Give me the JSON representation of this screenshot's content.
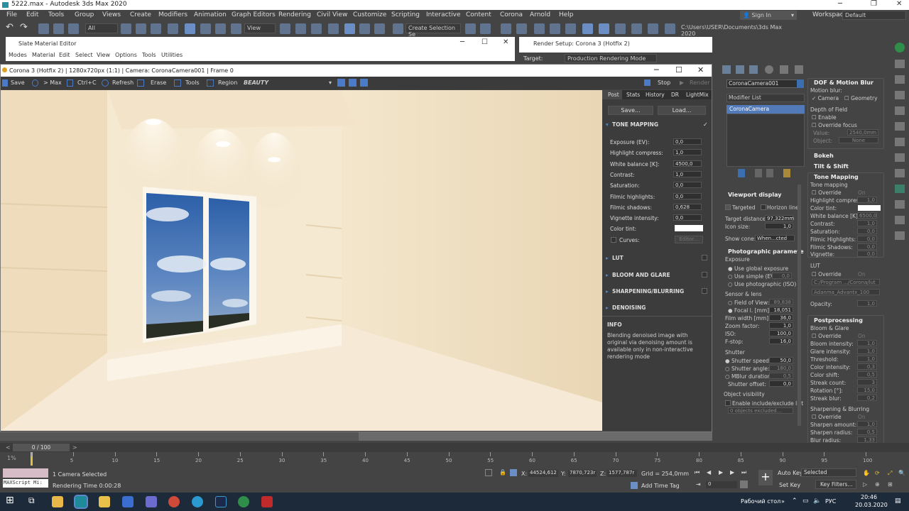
{
  "app": {
    "title": "5222.max - Autodesk 3ds Max 2020"
  },
  "menu": [
    "File",
    "Edit",
    "Tools",
    "Group",
    "Views",
    "Create",
    "Modifiers",
    "Animation",
    "Graph Editors",
    "Rendering",
    "Civil View",
    "Customize",
    "Scripting",
    "Interactive",
    "Content",
    "Corona",
    "Arnold",
    "Help"
  ],
  "account": {
    "signin": "Sign In",
    "workspaces": "Workspaces:",
    "workspace": "Default"
  },
  "toolbar": {
    "filter": "All",
    "refcoord": "View",
    "selset": "Create Selection Se",
    "path": "C:\\Users\\USER\\Documents\\3ds Max 2020"
  },
  "slate": {
    "title": "Slate Material Editor",
    "menu": [
      "Modes",
      "Material",
      "Edit",
      "Select",
      "View",
      "Options",
      "Tools",
      "Utilities"
    ]
  },
  "rsetup": {
    "title": "Render Setup: Corona 3 (Hotfix 2)",
    "target_label": "Target:",
    "target_value": "Production Rendering Mode"
  },
  "vfb": {
    "title": "Corona 3 (Hotfix 2) | 1280x720px (1:1) | Camera: CoronaCamera001 | Frame 0",
    "buttons": [
      "Save",
      "> Max",
      "Ctrl+C",
      "Refresh",
      "Erase",
      "Tools",
      "Region"
    ],
    "channel": "BEAUTY",
    "stop": "Stop",
    "render": "Render",
    "tabs": [
      "Post",
      "Stats",
      "History",
      "DR",
      "LightMix"
    ],
    "save_btn": "Save...",
    "load_btn": "Load...",
    "tone_mapping": "TONE MAPPING",
    "params": [
      {
        "label": "Exposure (EV):",
        "value": "0,0"
      },
      {
        "label": "Highlight compress:",
        "value": "1,0"
      },
      {
        "label": "White balance [K]:",
        "value": "4500,0"
      },
      {
        "label": "Contrast:",
        "value": "1,0"
      },
      {
        "label": "Saturation:",
        "value": "0,0"
      },
      {
        "label": "Filmic highlights:",
        "value": "0,0"
      },
      {
        "label": "Filmic shadows:",
        "value": "0,628"
      },
      {
        "label": "Vignette intensity:",
        "value": "0,0"
      }
    ],
    "color_tint": "Color tint:",
    "curves": "Curves:",
    "editor": "Editor...",
    "sections": [
      "LUT",
      "BLOOM AND GLARE",
      "SHARPENING/BLURRING",
      "DENOISING"
    ],
    "info_title": "INFO",
    "info_text": "Blending denoised image with original via denoising amount is available only in non-interactive rendering mode"
  },
  "modify": {
    "object": "CoronaCamera001",
    "modlist": "Modifier List",
    "stack": "CoronaCamera",
    "viewport_display": "Viewport display",
    "targeted": "Targeted",
    "horizon": "Horizon line",
    "target_distance": "Target distance:",
    "target_distance_v": "97,322mm",
    "icon_size": "Icon size:",
    "icon_size_v": "1,0",
    "show_cone": "Show cone:",
    "show_cone_v": "When...cted",
    "photo": "Photographic paramete",
    "exposure": "Exposure",
    "use_global": "Use global exposure",
    "use_simple": "Use simple (EV)",
    "use_simple_v": "0,0",
    "use_photo": "Use photographic (ISO)",
    "sensor": "Sensor & lens",
    "fov": "Field of View:",
    "fov_v": "89,838",
    "focal": "Focal l. [mm]:",
    "focal_v": "18,051",
    "film": "Film width [mm]:",
    "film_v": "36,0",
    "zoom": "Zoom factor:",
    "zoom_v": "1,0",
    "iso": "ISO:",
    "iso_v": "100,0",
    "fstop": "F-stop:",
    "fstop_v": "16,0",
    "shutter": "Shutter",
    "shutter_speed": "Shutter speed:",
    "shutter_speed_v": "50,0",
    "shutter_angle": "Shutter angle:",
    "shutter_angle_v": "180,0",
    "mblur": "MBlur duration:",
    "mblur_v": "0,5",
    "shutter_offset": "Shutter offset:",
    "shutter_offset_v": "0,0",
    "obj_vis": "Object visibility",
    "enable_incl": "Enable include/exclude list",
    "objects_excluded": "0 objects excluded..."
  },
  "rollout": {
    "dof": "DOF & Motion Blur",
    "motion_blur": "Motion blur:",
    "camera": "Camera",
    "geometry": "Geometry",
    "depth": "Depth of Field",
    "enable": "Enable",
    "override_focus": "Override focus",
    "value": "Value:",
    "value_v": "2540,0mm",
    "object": "Object:",
    "object_v": "None",
    "bokeh": "Bokeh",
    "tilt": "Tilt & Shift",
    "tm": "Tone Mapping",
    "tm_sub": "Tone mapping",
    "override": "Override",
    "on": "On",
    "hc": "Highlight compress:",
    "hc_v": "1,0",
    "ct": "Color tint:",
    "wb": "White balance [K]:",
    "wb_v": "6500,0",
    "contrast": "Contrast:",
    "contrast_v": "1,0",
    "sat": "Saturation:",
    "sat_v": "0,0",
    "fh": "Filmic Highlights:",
    "fh_v": "0,0",
    "fs": "Filmic Shadows:",
    "fs_v": "0,0",
    "vig": "Vignette:",
    "vig_v": "0,0",
    "lut": "LUT",
    "lut_path": "C:/Program .../Corona/lut",
    "lut_file": "Adanma_Advantx_100",
    "opacity": "Opacity:",
    "opacity_v": "1,0",
    "pp": "Postprocessing",
    "bg": "Bloom & Glare",
    "bi": "Bloom intensity:",
    "bi_v": "1,0",
    "gi": "Glare intensity:",
    "gi_v": "1,0",
    "thr": "Threshold:",
    "thr_v": "1,0",
    "ci": "Color intensity:",
    "ci_v": "0,3",
    "cs": "Color shift:",
    "cs_v": "0,5",
    "sc": "Streak count:",
    "sc_v": "3",
    "rot": "Rotation [°]:",
    "rot_v": "15,0",
    "sb": "Streak blur:",
    "sb_v": "0,2",
    "sharp": "Sharpening & Blurring",
    "sa": "Sharpen amount:",
    "sa_v": "1,0",
    "sr": "Sharpen radius:",
    "sr_v": "0,5",
    "br": "Blur radius:",
    "br_v": "1,33"
  },
  "timeline": {
    "frame": "0 / 100",
    "ticks": [
      "0",
      "5",
      "10",
      "15",
      "20",
      "25",
      "30",
      "35",
      "40",
      "45",
      "50",
      "55",
      "60",
      "65",
      "70",
      "75",
      "80",
      "85",
      "90",
      "95",
      "100"
    ]
  },
  "status": {
    "script": "MAXScript Mi:",
    "selected": "1 Camera Selected",
    "render_time": "Rendering Time  0:00:28",
    "x_label": "X:",
    "x": "44524,612",
    "y_label": "Y:",
    "y": "7870,723r",
    "z_label": "Z:",
    "z": "1577,787r",
    "grid": "Grid = 254,0mm",
    "add_tag": "Add Time Tag",
    "autokey": "Auto Key",
    "selected_dd": "Selected",
    "setkey": "Set Key",
    "keyfilters": "Key Filters...",
    "frame_field": "0"
  },
  "taskbar": {
    "desktop": "Рабочий стол",
    "lang": "РУС",
    "time": "20:46",
    "date": "20.03.2020"
  },
  "colors": {
    "accent": "#4a7ac8",
    "panel": "#444444",
    "render_bg": "#f1e3c8"
  }
}
